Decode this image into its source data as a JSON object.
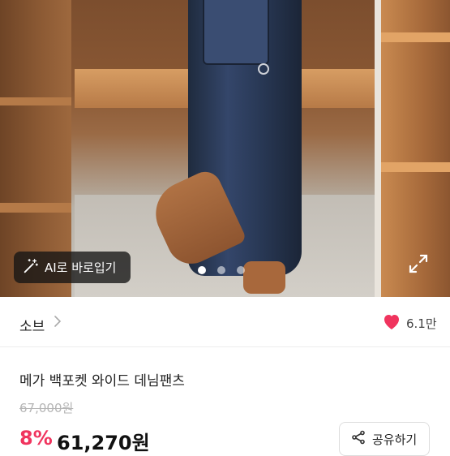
{
  "hero": {
    "ai_button_label": "AI로 바로입기",
    "ai_icon": "magic-wand-icon",
    "expand_icon": "expand-icon",
    "carousel": {
      "total": 3,
      "active_index": 1
    }
  },
  "shop": {
    "name": "소브",
    "chevron_icon": "chevron-right-icon",
    "like_icon": "heart-icon",
    "like_count": "6.1만"
  },
  "product": {
    "title": "메가 백포켓 와이드 데님팬츠",
    "original_price": "67,000원",
    "discount": "8%",
    "price": "61,270원"
  },
  "share": {
    "label": "공유하기",
    "icon": "share-icon"
  },
  "colors": {
    "accent": "#f0345e",
    "heart": "#f0345e"
  }
}
